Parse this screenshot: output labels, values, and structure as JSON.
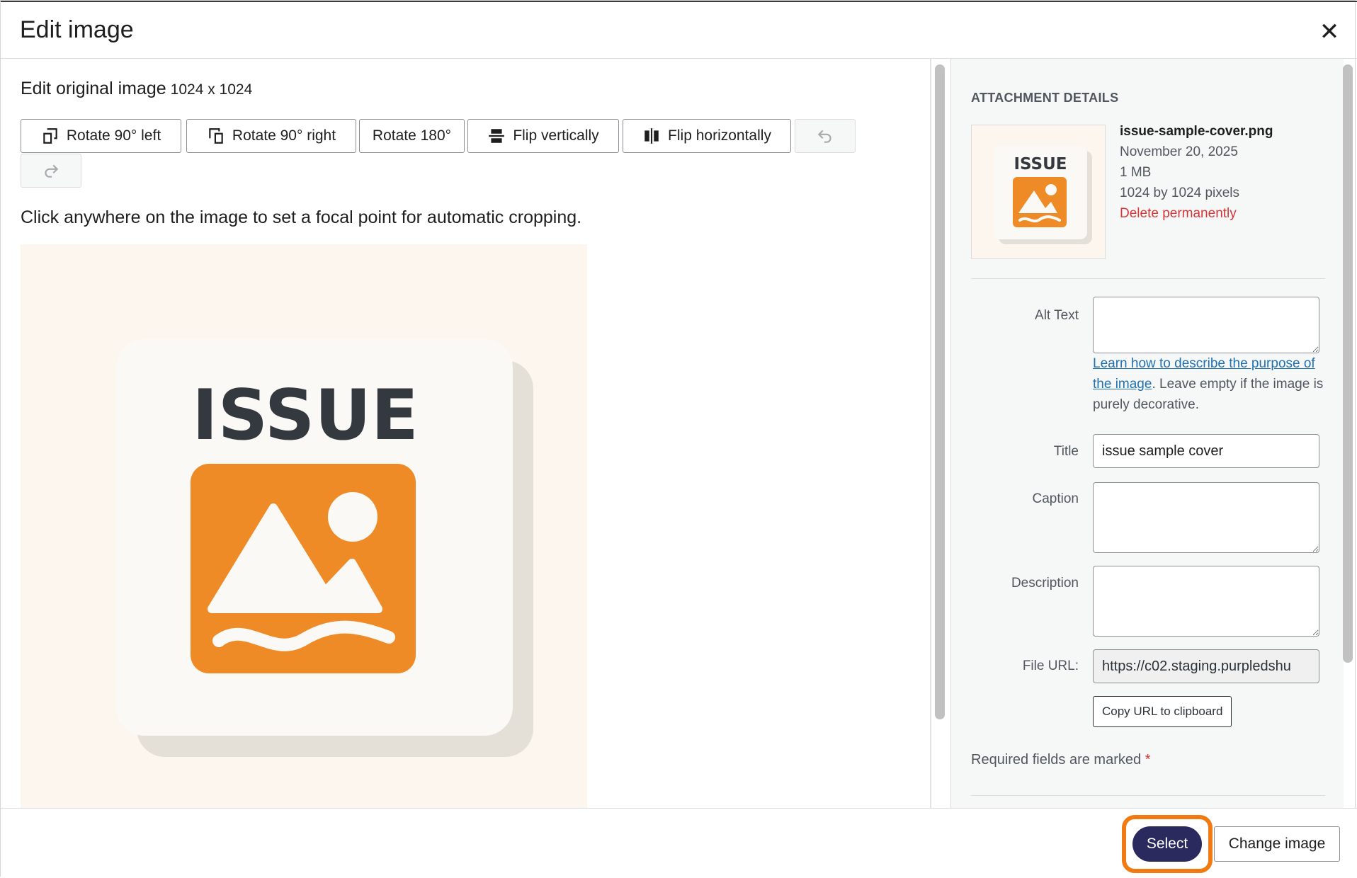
{
  "modal": {
    "title": "Edit image",
    "close_icon": "close-icon"
  },
  "editor": {
    "original_label": "Edit original image",
    "original_size": "1024 x 1024",
    "tools": {
      "rotate_left": "Rotate 90° left",
      "rotate_right": "Rotate 90° right",
      "rotate_180": "Rotate 180°",
      "flip_vertical": "Flip vertically",
      "flip_horizontal": "Flip horizontally",
      "undo_icon": "undo-icon",
      "redo_icon": "redo-icon"
    },
    "focal_hint": "Click anywhere on the image to set a focal point for automatic cropping.",
    "image_text": "ISSUE",
    "accent_color": "#ef8b26"
  },
  "sidebar": {
    "heading": "ATTACHMENT DETAILS",
    "thumb_text": "ISSUE",
    "file_name": "issue-sample-cover.png",
    "date": "November 20, 2025",
    "file_size": "1 MB",
    "dimensions": "1024 by 1024 pixels",
    "delete_label": "Delete permanently",
    "fields": {
      "alt_label": "Alt Text",
      "alt_value": "",
      "help_link": "Learn how to describe the purpose of the image",
      "help_text": ". Leave empty if the image is purely decorative.",
      "title_label": "Title",
      "title_value": "issue sample cover",
      "caption_label": "Caption",
      "caption_value": "",
      "description_label": "Description",
      "description_value": "",
      "file_url_label": "File URL:",
      "file_url_value": "https://c02.staging.purpledshu"
    },
    "copy_label": "Copy URL to clipboard",
    "required_text": "Required fields are marked",
    "required_mark": "*"
  },
  "footer": {
    "select_label": "Select",
    "change_label": "Change image",
    "highlight_color": "#f07a14"
  }
}
